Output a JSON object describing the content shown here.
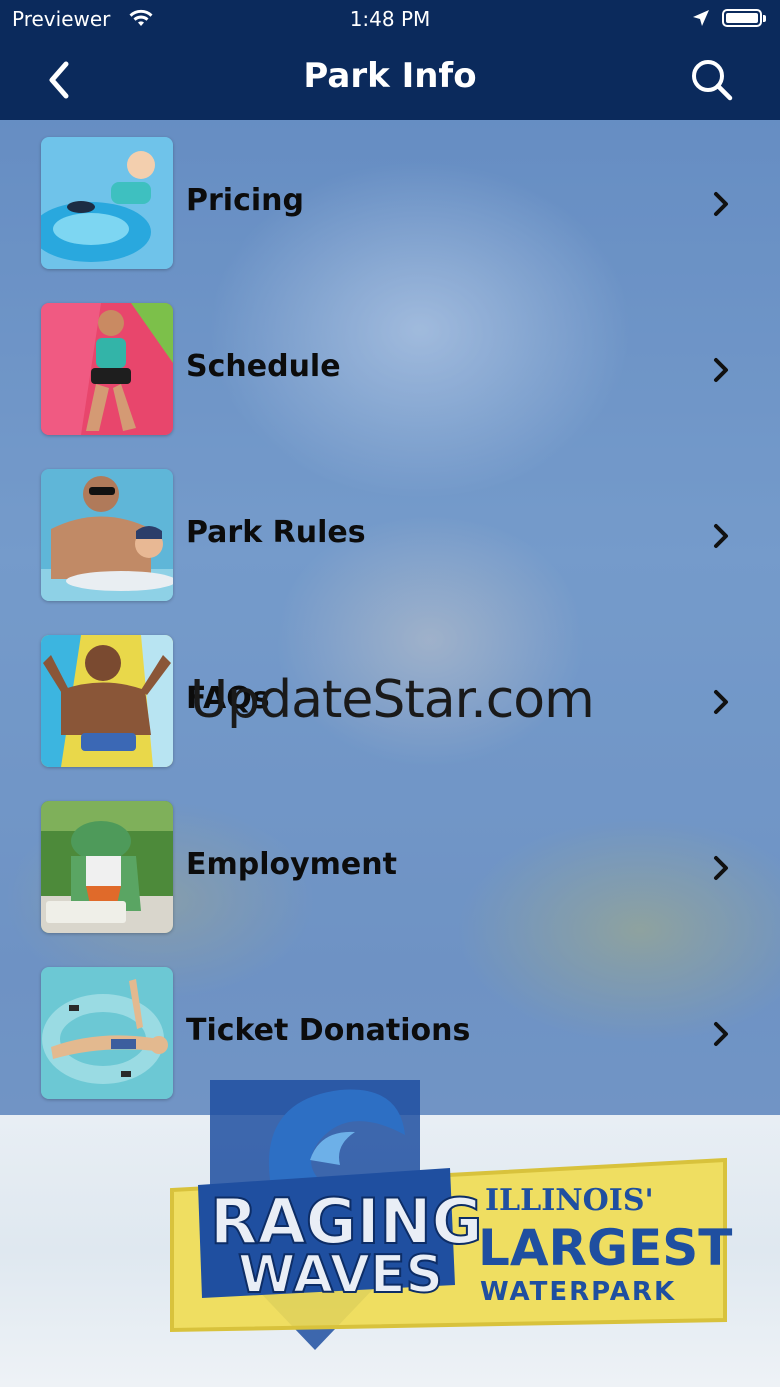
{
  "status_bar": {
    "carrier": "Previewer",
    "time": "1:48 PM"
  },
  "nav": {
    "title": "Park Info"
  },
  "menu": [
    {
      "label": "Pricing",
      "thumb_color": "#6fc3ea"
    },
    {
      "label": "Schedule",
      "thumb_color": "#e8466c"
    },
    {
      "label": "Park Rules",
      "thumb_color": "#5fb6d8"
    },
    {
      "label": "FAQs",
      "thumb_color": "#e9d84a"
    },
    {
      "label": "Employment",
      "thumb_color": "#4d8a3a"
    },
    {
      "label": "Ticket Donations",
      "thumb_color": "#6cc8d4"
    }
  ],
  "watermark": "UpdateStar.com",
  "logo": {
    "line1": "RAGING",
    "line2": "WAVES",
    "tag1": "ILLINOIS'",
    "tag2": "LARGEST",
    "tag3": "WATERPARK"
  },
  "colors": {
    "nav_bg": "#0b2a5c",
    "logo_yellow": "#f0dc55",
    "logo_blue": "#1f4fa0"
  }
}
